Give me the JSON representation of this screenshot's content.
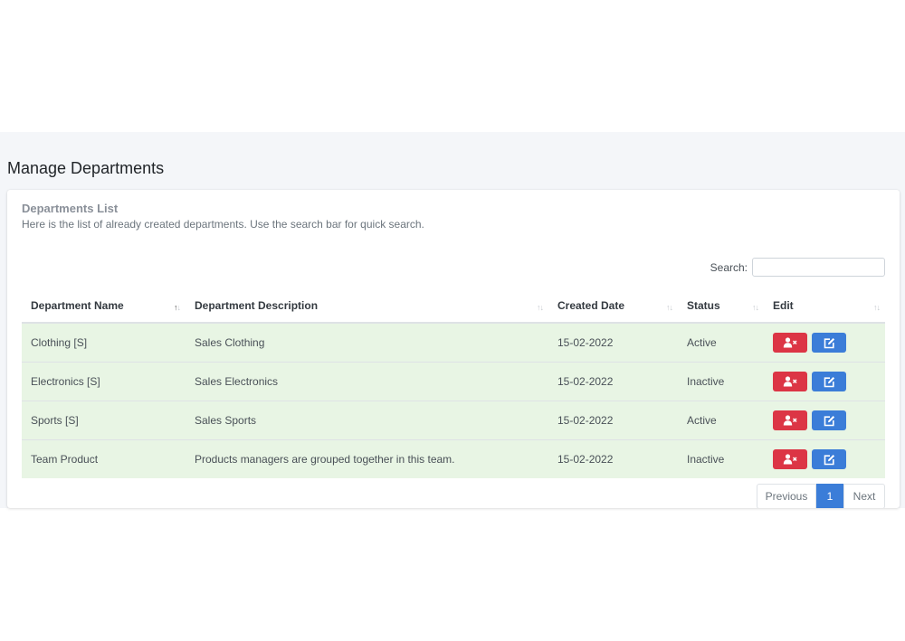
{
  "page": {
    "title": "Manage Departments"
  },
  "card": {
    "title": "Departments List",
    "subtitle": "Here is the list of already created departments. Use the search bar for quick search."
  },
  "search": {
    "label": "Search:",
    "value": "",
    "placeholder": ""
  },
  "table": {
    "headers": {
      "name": "Department Name",
      "description": "Department Description",
      "created": "Created Date",
      "status": "Status",
      "edit": "Edit"
    },
    "rows": [
      {
        "name": "Clothing [S]",
        "description": "Sales Clothing",
        "created": "15-02-2022",
        "status": "Active"
      },
      {
        "name": "Electronics [S]",
        "description": "Sales Electronics",
        "created": "15-02-2022",
        "status": "Inactive"
      },
      {
        "name": "Sports [S]",
        "description": "Sales Sports",
        "created": "15-02-2022",
        "status": "Active"
      },
      {
        "name": "Team Product",
        "description": "Products managers are grouped together in this team.",
        "created": "15-02-2022",
        "status": "Inactive"
      }
    ],
    "row_actions": {
      "delete_icon": "user-remove-icon",
      "edit_icon": "edit-icon"
    }
  },
  "pagination": {
    "previous": "Previous",
    "current": "1",
    "next": "Next"
  },
  "colors": {
    "row_bg": "#e8f5e4",
    "danger": "#dc3545",
    "primary": "#3b7dd8",
    "app_bg": "#f4f6f9"
  }
}
